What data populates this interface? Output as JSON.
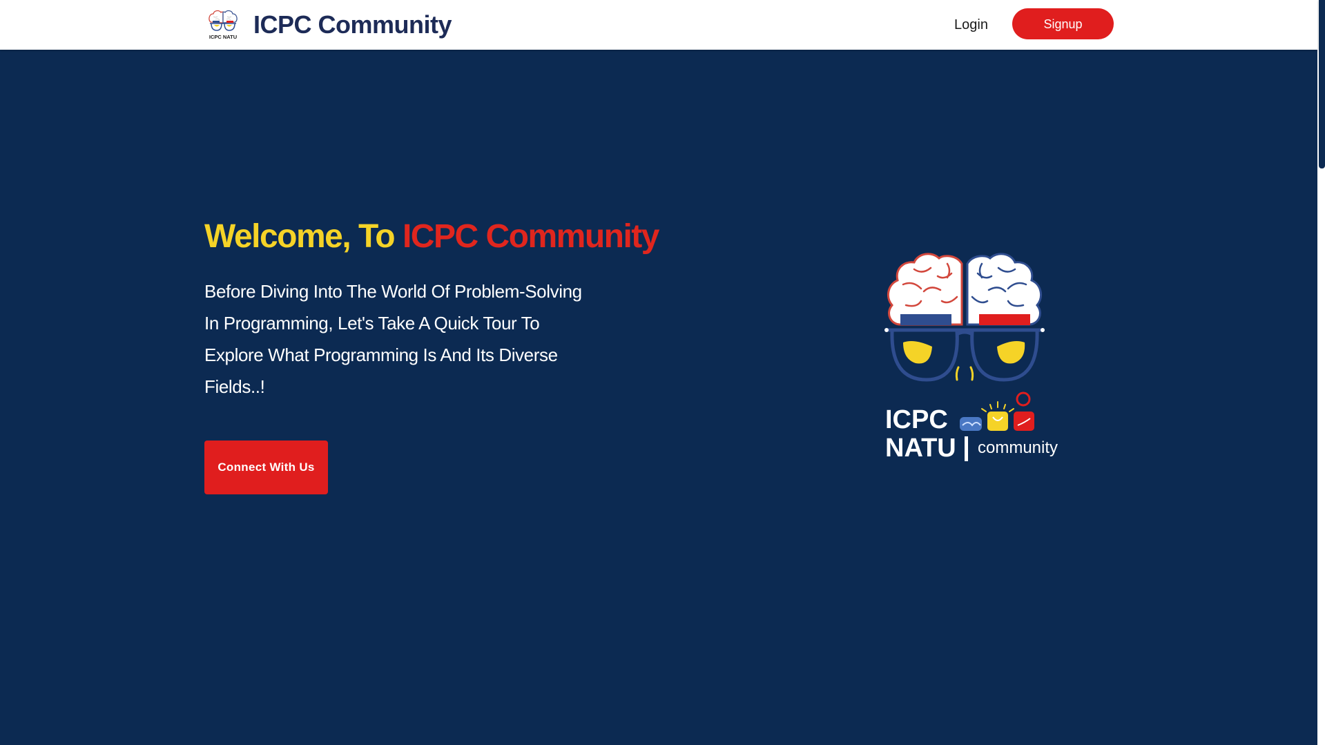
{
  "navbar": {
    "brand_title": "ICPC Community",
    "logo_caption": "ICPC NATU",
    "login_label": "Login",
    "signup_label": "Signup"
  },
  "hero": {
    "heading_part1": "Welcome, To",
    "heading_part2": "ICPC Community",
    "description": "Before Diving Into The World Of Problem-Solving In Programming, Let's Take A Quick Tour To Explore What Programming Is And Its Diverse Fields..!",
    "cta_label": "Connect With Us"
  },
  "hero_logo": {
    "line1": "ICPC",
    "line2": "NATU",
    "subtitle": "community"
  },
  "colors": {
    "background": "#0c2a52",
    "accent_red": "#e01e1e",
    "accent_yellow": "#f5d327",
    "brand_navy": "#1d2b57",
    "brain_blue": "#2f4d8f"
  },
  "icons": [
    "icpc-brain-logo",
    "brain-glasses-logo",
    "handshake-icon",
    "lightbulb-icon",
    "pin-icon"
  ]
}
